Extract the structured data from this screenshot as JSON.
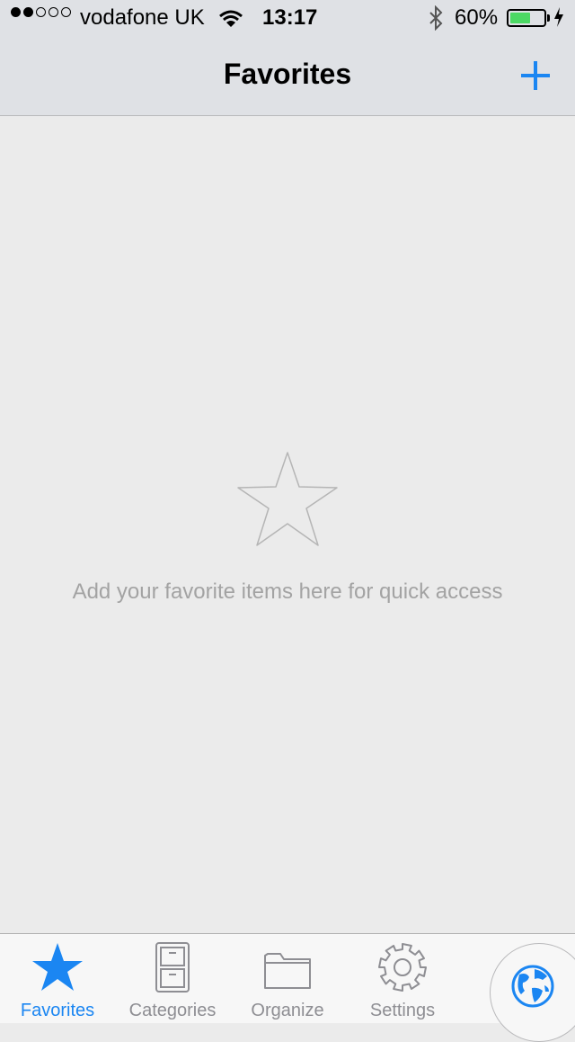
{
  "status_bar": {
    "carrier": "vodafone UK",
    "time": "13:17",
    "battery_percent": "60%",
    "signal_bars_filled": 2,
    "signal_bars_total": 5,
    "battery_fraction": 0.6,
    "icons": [
      "wifi-icon",
      "bluetooth-icon",
      "battery-icon",
      "charging-icon"
    ]
  },
  "nav": {
    "title": "Favorites",
    "add_icon": "plus-icon",
    "accent_color": "#1b86f2"
  },
  "empty_state": {
    "icon": "star-outline-icon",
    "message": "Add your favorite items here for quick access"
  },
  "tabbar": {
    "tabs": [
      {
        "label": "Favorites",
        "icon": "star-icon",
        "active": true
      },
      {
        "label": "Categories",
        "icon": "file-cabinet-icon",
        "active": false
      },
      {
        "label": "Organize",
        "icon": "folder-icon",
        "active": false
      },
      {
        "label": "Settings",
        "icon": "gear-icon",
        "active": false
      }
    ],
    "globe_icon": "globe-icon"
  }
}
